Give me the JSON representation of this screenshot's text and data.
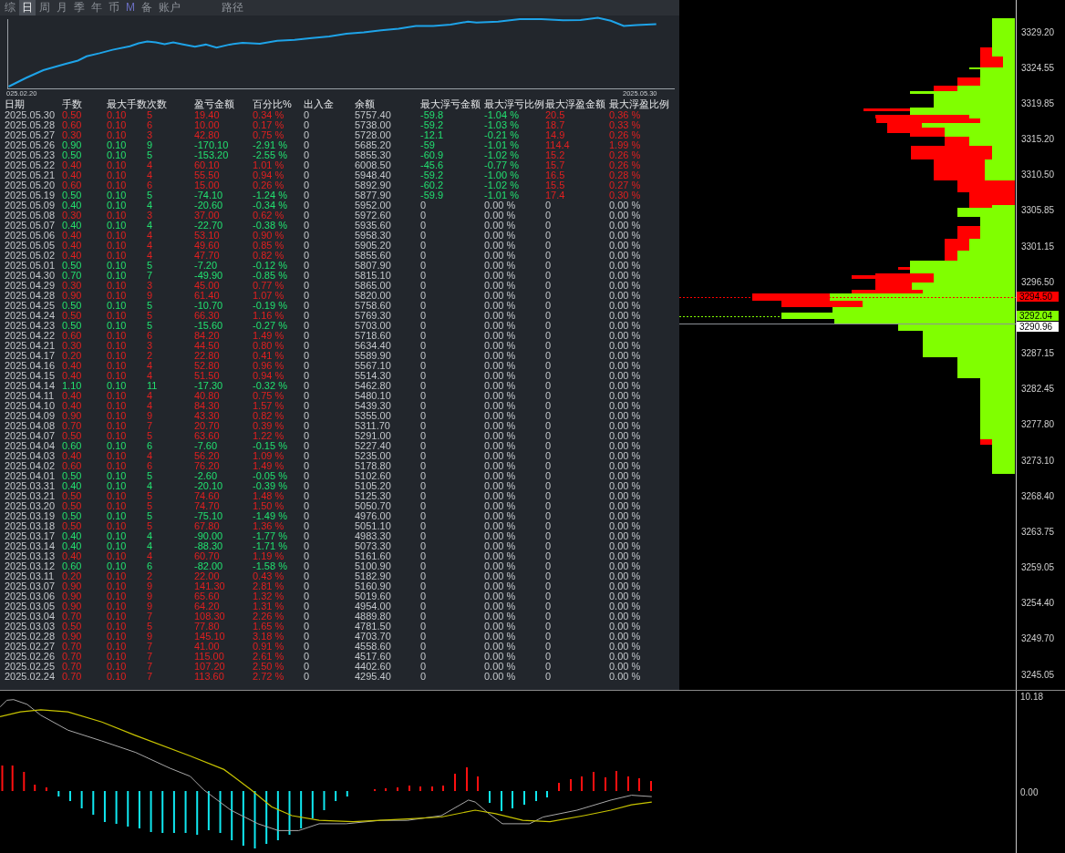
{
  "tabs": [
    {
      "label": "综",
      "selected": false,
      "accent": false
    },
    {
      "label": "日",
      "selected": true,
      "accent": false
    },
    {
      "label": "周",
      "selected": false,
      "accent": false
    },
    {
      "label": "月",
      "selected": false,
      "accent": false
    },
    {
      "label": "季",
      "selected": false,
      "accent": false
    },
    {
      "label": "年",
      "selected": false,
      "accent": false
    },
    {
      "label": "币",
      "selected": false,
      "accent": false
    },
    {
      "label": "M",
      "selected": false,
      "accent": true
    },
    {
      "label": "备",
      "selected": false,
      "accent": false
    },
    {
      "label": "账户",
      "selected": false,
      "accent": false
    }
  ],
  "path_tab": {
    "label": "路径",
    "selected": false
  },
  "equity_chart": {
    "start_label": "025.02.20",
    "end_label": "2025.05.30"
  },
  "table": {
    "columns": [
      "日期",
      "手数",
      "最大手数",
      "次数",
      "盈亏金额",
      "百分比%",
      "出入金",
      "余额",
      "最大浮亏金额",
      "最大浮亏比例",
      "最大浮盈金额",
      "最大浮盈比例"
    ],
    "rows": [
      {
        "cells": [
          "2025.05.30",
          "0.50",
          "0.10",
          "5",
          "19.40",
          "0.34 %",
          "0",
          "5757.40",
          "-59.8",
          "-1.04 %",
          "20.5",
          "0.36 %"
        ],
        "kind": "profit",
        "floating": true
      },
      {
        "cells": [
          "2025.05.28",
          "0.60",
          "0.10",
          "6",
          "10.00",
          "0.17 %",
          "0",
          "5738.00",
          "-59.2",
          "-1.03 %",
          "18.7",
          "0.33 %"
        ],
        "kind": "profit",
        "floating": true
      },
      {
        "cells": [
          "2025.05.27",
          "0.30",
          "0.10",
          "3",
          "42.80",
          "0.75 %",
          "0",
          "5728.00",
          "-12.1",
          "-0.21 %",
          "14.9",
          "0.26 %"
        ],
        "kind": "profit",
        "floating": true
      },
      {
        "cells": [
          "2025.05.26",
          "0.90",
          "0.10",
          "9",
          "-170.10",
          "-2.91 %",
          "0",
          "5685.20",
          "-59",
          "-1.01 %",
          "114.4",
          "1.99 %"
        ],
        "kind": "loss",
        "floating": true
      },
      {
        "cells": [
          "2025.05.23",
          "0.50",
          "0.10",
          "5",
          "-153.20",
          "-2.55 %",
          "0",
          "5855.30",
          "-60.9",
          "-1.02 %",
          "15.2",
          "0.26 %"
        ],
        "kind": "loss",
        "floating": true
      },
      {
        "cells": [
          "2025.05.22",
          "0.40",
          "0.10",
          "4",
          "60.10",
          "1.01 %",
          "0",
          "6008.50",
          "-45.6",
          "-0.77 %",
          "15.7",
          "0.26 %"
        ],
        "kind": "profit",
        "floating": true
      },
      {
        "cells": [
          "2025.05.21",
          "0.40",
          "0.10",
          "4",
          "55.50",
          "0.94 %",
          "0",
          "5948.40",
          "-59.2",
          "-1.00 %",
          "16.5",
          "0.28 %"
        ],
        "kind": "profit",
        "floating": true
      },
      {
        "cells": [
          "2025.05.20",
          "0.60",
          "0.10",
          "6",
          "15.00",
          "0.26 %",
          "0",
          "5892.90",
          "-60.2",
          "-1.02 %",
          "15.5",
          "0.27 %"
        ],
        "kind": "profit",
        "floating": true
      },
      {
        "cells": [
          "2025.05.19",
          "0.50",
          "0.10",
          "5",
          "-74.10",
          "-1.24 %",
          "0",
          "5877.90",
          "-59.9",
          "-1.01 %",
          "17.4",
          "0.30 %"
        ],
        "kind": "loss",
        "floating": true
      },
      {
        "cells": [
          "2025.05.09",
          "0.40",
          "0.10",
          "4",
          "-20.60",
          "-0.34 %",
          "0",
          "5952.00",
          "0",
          "0.00 %",
          "0",
          "0.00 %"
        ],
        "kind": "loss",
        "floating": false
      },
      {
        "cells": [
          "2025.05.08",
          "0.30",
          "0.10",
          "3",
          "37.00",
          "0.62 %",
          "0",
          "5972.60",
          "0",
          "0.00 %",
          "0",
          "0.00 %"
        ],
        "kind": "profit",
        "floating": false
      },
      {
        "cells": [
          "2025.05.07",
          "0.40",
          "0.10",
          "4",
          "-22.70",
          "-0.38 %",
          "0",
          "5935.60",
          "0",
          "0.00 %",
          "0",
          "0.00 %"
        ],
        "kind": "loss",
        "floating": false
      },
      {
        "cells": [
          "2025.05.06",
          "0.40",
          "0.10",
          "4",
          "53.10",
          "0.90 %",
          "0",
          "5958.30",
          "0",
          "0.00 %",
          "0",
          "0.00 %"
        ],
        "kind": "profit",
        "floating": false
      },
      {
        "cells": [
          "2025.05.05",
          "0.40",
          "0.10",
          "4",
          "49.60",
          "0.85 %",
          "0",
          "5905.20",
          "0",
          "0.00 %",
          "0",
          "0.00 %"
        ],
        "kind": "profit",
        "floating": false
      },
      {
        "cells": [
          "2025.05.02",
          "0.40",
          "0.10",
          "4",
          "47.70",
          "0.82 %",
          "0",
          "5855.60",
          "0",
          "0.00 %",
          "0",
          "0.00 %"
        ],
        "kind": "profit",
        "floating": false
      },
      {
        "cells": [
          "2025.05.01",
          "0.50",
          "0.10",
          "5",
          "-7.20",
          "-0.12 %",
          "0",
          "5807.90",
          "0",
          "0.00 %",
          "0",
          "0.00 %"
        ],
        "kind": "loss",
        "floating": false
      },
      {
        "cells": [
          "2025.04.30",
          "0.70",
          "0.10",
          "7",
          "-49.90",
          "-0.85 %",
          "0",
          "5815.10",
          "0",
          "0.00 %",
          "0",
          "0.00 %"
        ],
        "kind": "loss",
        "floating": false
      },
      {
        "cells": [
          "2025.04.29",
          "0.30",
          "0.10",
          "3",
          "45.00",
          "0.77 %",
          "0",
          "5865.00",
          "0",
          "0.00 %",
          "0",
          "0.00 %"
        ],
        "kind": "profit",
        "floating": false
      },
      {
        "cells": [
          "2025.04.28",
          "0.90",
          "0.10",
          "9",
          "61.40",
          "1.07 %",
          "0",
          "5820.00",
          "0",
          "0.00 %",
          "0",
          "0.00 %"
        ],
        "kind": "profit",
        "floating": false
      },
      {
        "cells": [
          "2025.04.25",
          "0.50",
          "0.10",
          "5",
          "-10.70",
          "-0.19 %",
          "0",
          "5758.60",
          "0",
          "0.00 %",
          "0",
          "0.00 %"
        ],
        "kind": "loss",
        "floating": false
      },
      {
        "cells": [
          "2025.04.24",
          "0.50",
          "0.10",
          "5",
          "66.30",
          "1.16 %",
          "0",
          "5769.30",
          "0",
          "0.00 %",
          "0",
          "0.00 %"
        ],
        "kind": "profit",
        "floating": false
      },
      {
        "cells": [
          "2025.04.23",
          "0.50",
          "0.10",
          "5",
          "-15.60",
          "-0.27 %",
          "0",
          "5703.00",
          "0",
          "0.00 %",
          "0",
          "0.00 %"
        ],
        "kind": "loss",
        "floating": false
      },
      {
        "cells": [
          "2025.04.22",
          "0.60",
          "0.10",
          "6",
          "84.20",
          "1.49 %",
          "0",
          "5718.60",
          "0",
          "0.00 %",
          "0",
          "0.00 %"
        ],
        "kind": "profit",
        "floating": false
      },
      {
        "cells": [
          "2025.04.21",
          "0.30",
          "0.10",
          "3",
          "44.50",
          "0.80 %",
          "0",
          "5634.40",
          "0",
          "0.00 %",
          "0",
          "0.00 %"
        ],
        "kind": "profit",
        "floating": false
      },
      {
        "cells": [
          "2025.04.17",
          "0.20",
          "0.10",
          "2",
          "22.80",
          "0.41 %",
          "0",
          "5589.90",
          "0",
          "0.00 %",
          "0",
          "0.00 %"
        ],
        "kind": "profit",
        "floating": false
      },
      {
        "cells": [
          "2025.04.16",
          "0.40",
          "0.10",
          "4",
          "52.80",
          "0.96 %",
          "0",
          "5567.10",
          "0",
          "0.00 %",
          "0",
          "0.00 %"
        ],
        "kind": "profit",
        "floating": false
      },
      {
        "cells": [
          "2025.04.15",
          "0.40",
          "0.10",
          "4",
          "51.50",
          "0.94 %",
          "0",
          "5514.30",
          "0",
          "0.00 %",
          "0",
          "0.00 %"
        ],
        "kind": "profit",
        "floating": false
      },
      {
        "cells": [
          "2025.04.14",
          "1.10",
          "0.10",
          "11",
          "-17.30",
          "-0.32 %",
          "0",
          "5462.80",
          "0",
          "0.00 %",
          "0",
          "0.00 %"
        ],
        "kind": "loss",
        "floating": false
      },
      {
        "cells": [
          "2025.04.11",
          "0.40",
          "0.10",
          "4",
          "40.80",
          "0.75 %",
          "0",
          "5480.10",
          "0",
          "0.00 %",
          "0",
          "0.00 %"
        ],
        "kind": "profit",
        "floating": false
      },
      {
        "cells": [
          "2025.04.10",
          "0.40",
          "0.10",
          "4",
          "84.30",
          "1.57 %",
          "0",
          "5439.30",
          "0",
          "0.00 %",
          "0",
          "0.00 %"
        ],
        "kind": "profit",
        "floating": false
      },
      {
        "cells": [
          "2025.04.09",
          "0.90",
          "0.10",
          "9",
          "43.30",
          "0.82 %",
          "0",
          "5355.00",
          "0",
          "0.00 %",
          "0",
          "0.00 %"
        ],
        "kind": "profit",
        "floating": false
      },
      {
        "cells": [
          "2025.04.08",
          "0.70",
          "0.10",
          "7",
          "20.70",
          "0.39 %",
          "0",
          "5311.70",
          "0",
          "0.00 %",
          "0",
          "0.00 %"
        ],
        "kind": "profit",
        "floating": false
      },
      {
        "cells": [
          "2025.04.07",
          "0.50",
          "0.10",
          "5",
          "63.60",
          "1.22 %",
          "0",
          "5291.00",
          "0",
          "0.00 %",
          "0",
          "0.00 %"
        ],
        "kind": "profit",
        "floating": false
      },
      {
        "cells": [
          "2025.04.04",
          "0.60",
          "0.10",
          "6",
          "-7.60",
          "-0.15 %",
          "0",
          "5227.40",
          "0",
          "0.00 %",
          "0",
          "0.00 %"
        ],
        "kind": "loss",
        "floating": false
      },
      {
        "cells": [
          "2025.04.03",
          "0.40",
          "0.10",
          "4",
          "56.20",
          "1.09 %",
          "0",
          "5235.00",
          "0",
          "0.00 %",
          "0",
          "0.00 %"
        ],
        "kind": "profit",
        "floating": false
      },
      {
        "cells": [
          "2025.04.02",
          "0.60",
          "0.10",
          "6",
          "76.20",
          "1.49 %",
          "0",
          "5178.80",
          "0",
          "0.00 %",
          "0",
          "0.00 %"
        ],
        "kind": "profit",
        "floating": false
      },
      {
        "cells": [
          "2025.04.01",
          "0.50",
          "0.10",
          "5",
          "-2.60",
          "-0.05 %",
          "0",
          "5102.60",
          "0",
          "0.00 %",
          "0",
          "0.00 %"
        ],
        "kind": "loss",
        "floating": false
      },
      {
        "cells": [
          "2025.03.31",
          "0.40",
          "0.10",
          "4",
          "-20.10",
          "-0.39 %",
          "0",
          "5105.20",
          "0",
          "0.00 %",
          "0",
          "0.00 %"
        ],
        "kind": "loss",
        "floating": false
      },
      {
        "cells": [
          "2025.03.21",
          "0.50",
          "0.10",
          "5",
          "74.60",
          "1.48 %",
          "0",
          "5125.30",
          "0",
          "0.00 %",
          "0",
          "0.00 %"
        ],
        "kind": "profit",
        "floating": false
      },
      {
        "cells": [
          "2025.03.20",
          "0.50",
          "0.10",
          "5",
          "74.70",
          "1.50 %",
          "0",
          "5050.70",
          "0",
          "0.00 %",
          "0",
          "0.00 %"
        ],
        "kind": "profit",
        "floating": false
      },
      {
        "cells": [
          "2025.03.19",
          "0.50",
          "0.10",
          "5",
          "-75.10",
          "-1.49 %",
          "0",
          "4976.00",
          "0",
          "0.00 %",
          "0",
          "0.00 %"
        ],
        "kind": "loss",
        "floating": false
      },
      {
        "cells": [
          "2025.03.18",
          "0.50",
          "0.10",
          "5",
          "67.80",
          "1.36 %",
          "0",
          "5051.10",
          "0",
          "0.00 %",
          "0",
          "0.00 %"
        ],
        "kind": "profit",
        "floating": false
      },
      {
        "cells": [
          "2025.03.17",
          "0.40",
          "0.10",
          "4",
          "-90.00",
          "-1.77 %",
          "0",
          "4983.30",
          "0",
          "0.00 %",
          "0",
          "0.00 %"
        ],
        "kind": "loss",
        "floating": false
      },
      {
        "cells": [
          "2025.03.14",
          "0.40",
          "0.10",
          "4",
          "-88.30",
          "-1.71 %",
          "0",
          "5073.30",
          "0",
          "0.00 %",
          "0",
          "0.00 %"
        ],
        "kind": "loss",
        "floating": false
      },
      {
        "cells": [
          "2025.03.13",
          "0.40",
          "0.10",
          "4",
          "60.70",
          "1.19 %",
          "0",
          "5161.60",
          "0",
          "0.00 %",
          "0",
          "0.00 %"
        ],
        "kind": "profit",
        "floating": false
      },
      {
        "cells": [
          "2025.03.12",
          "0.60",
          "0.10",
          "6",
          "-82.00",
          "-1.58 %",
          "0",
          "5100.90",
          "0",
          "0.00 %",
          "0",
          "0.00 %"
        ],
        "kind": "loss",
        "floating": false
      },
      {
        "cells": [
          "2025.03.11",
          "0.20",
          "0.10",
          "2",
          "22.00",
          "0.43 %",
          "0",
          "5182.90",
          "0",
          "0.00 %",
          "0",
          "0.00 %"
        ],
        "kind": "profit",
        "floating": false
      },
      {
        "cells": [
          "2025.03.07",
          "0.90",
          "0.10",
          "9",
          "141.30",
          "2.81 %",
          "0",
          "5160.90",
          "0",
          "0.00 %",
          "0",
          "0.00 %"
        ],
        "kind": "profit",
        "floating": false
      },
      {
        "cells": [
          "2025.03.06",
          "0.90",
          "0.10",
          "9",
          "65.60",
          "1.32 %",
          "0",
          "5019.60",
          "0",
          "0.00 %",
          "0",
          "0.00 %"
        ],
        "kind": "profit",
        "floating": false
      },
      {
        "cells": [
          "2025.03.05",
          "0.90",
          "0.10",
          "9",
          "64.20",
          "1.31 %",
          "0",
          "4954.00",
          "0",
          "0.00 %",
          "0",
          "0.00 %"
        ],
        "kind": "profit",
        "floating": false
      },
      {
        "cells": [
          "2025.03.04",
          "0.70",
          "0.10",
          "7",
          "108.30",
          "2.26 %",
          "0",
          "4889.80",
          "0",
          "0.00 %",
          "0",
          "0.00 %"
        ],
        "kind": "profit",
        "floating": false
      },
      {
        "cells": [
          "2025.03.03",
          "0.50",
          "0.10",
          "5",
          "77.80",
          "1.65 %",
          "0",
          "4781.50",
          "0",
          "0.00 %",
          "0",
          "0.00 %"
        ],
        "kind": "profit",
        "floating": false
      },
      {
        "cells": [
          "2025.02.28",
          "0.90",
          "0.10",
          "9",
          "145.10",
          "3.18 %",
          "0",
          "4703.70",
          "0",
          "0.00 %",
          "0",
          "0.00 %"
        ],
        "kind": "profit",
        "floating": false
      },
      {
        "cells": [
          "2025.02.27",
          "0.70",
          "0.10",
          "7",
          "41.00",
          "0.91 %",
          "0",
          "4558.60",
          "0",
          "0.00 %",
          "0",
          "0.00 %"
        ],
        "kind": "profit",
        "floating": false
      },
      {
        "cells": [
          "2025.02.26",
          "0.70",
          "0.10",
          "7",
          "115.00",
          "2.61 %",
          "0",
          "4517.60",
          "0",
          "0.00 %",
          "0",
          "0.00 %"
        ],
        "kind": "profit",
        "floating": false
      },
      {
        "cells": [
          "2025.02.25",
          "0.70",
          "0.10",
          "7",
          "107.20",
          "2.50 %",
          "0",
          "4402.60",
          "0",
          "0.00 %",
          "0",
          "0.00 %"
        ],
        "kind": "profit",
        "floating": false
      },
      {
        "cells": [
          "2025.02.24",
          "0.70",
          "0.10",
          "7",
          "113.60",
          "2.72 %",
          "0",
          "4295.40",
          "0",
          "0.00 %",
          "0",
          "0.00 %"
        ],
        "kind": "profit",
        "floating": false
      }
    ]
  },
  "price_axis": {
    "labels": [
      "3329.20",
      "3324.55",
      "3319.85",
      "3315.20",
      "3310.50",
      "3305.85",
      "3301.15",
      "3296.50",
      "3287.15",
      "3282.45",
      "3277.80",
      "3273.10",
      "3268.40",
      "3263.75",
      "3259.05",
      "3254.40",
      "3249.70",
      "3245.05"
    ],
    "tags": [
      {
        "label": "3294.50",
        "color": "#ff0000"
      },
      {
        "label": "3292.04",
        "color": "#80ff00"
      },
      {
        "label": "3290.96",
        "color": "#ffffff"
      }
    ]
  },
  "indicator": {
    "scale": [
      "10.18",
      "0.00"
    ]
  }
}
